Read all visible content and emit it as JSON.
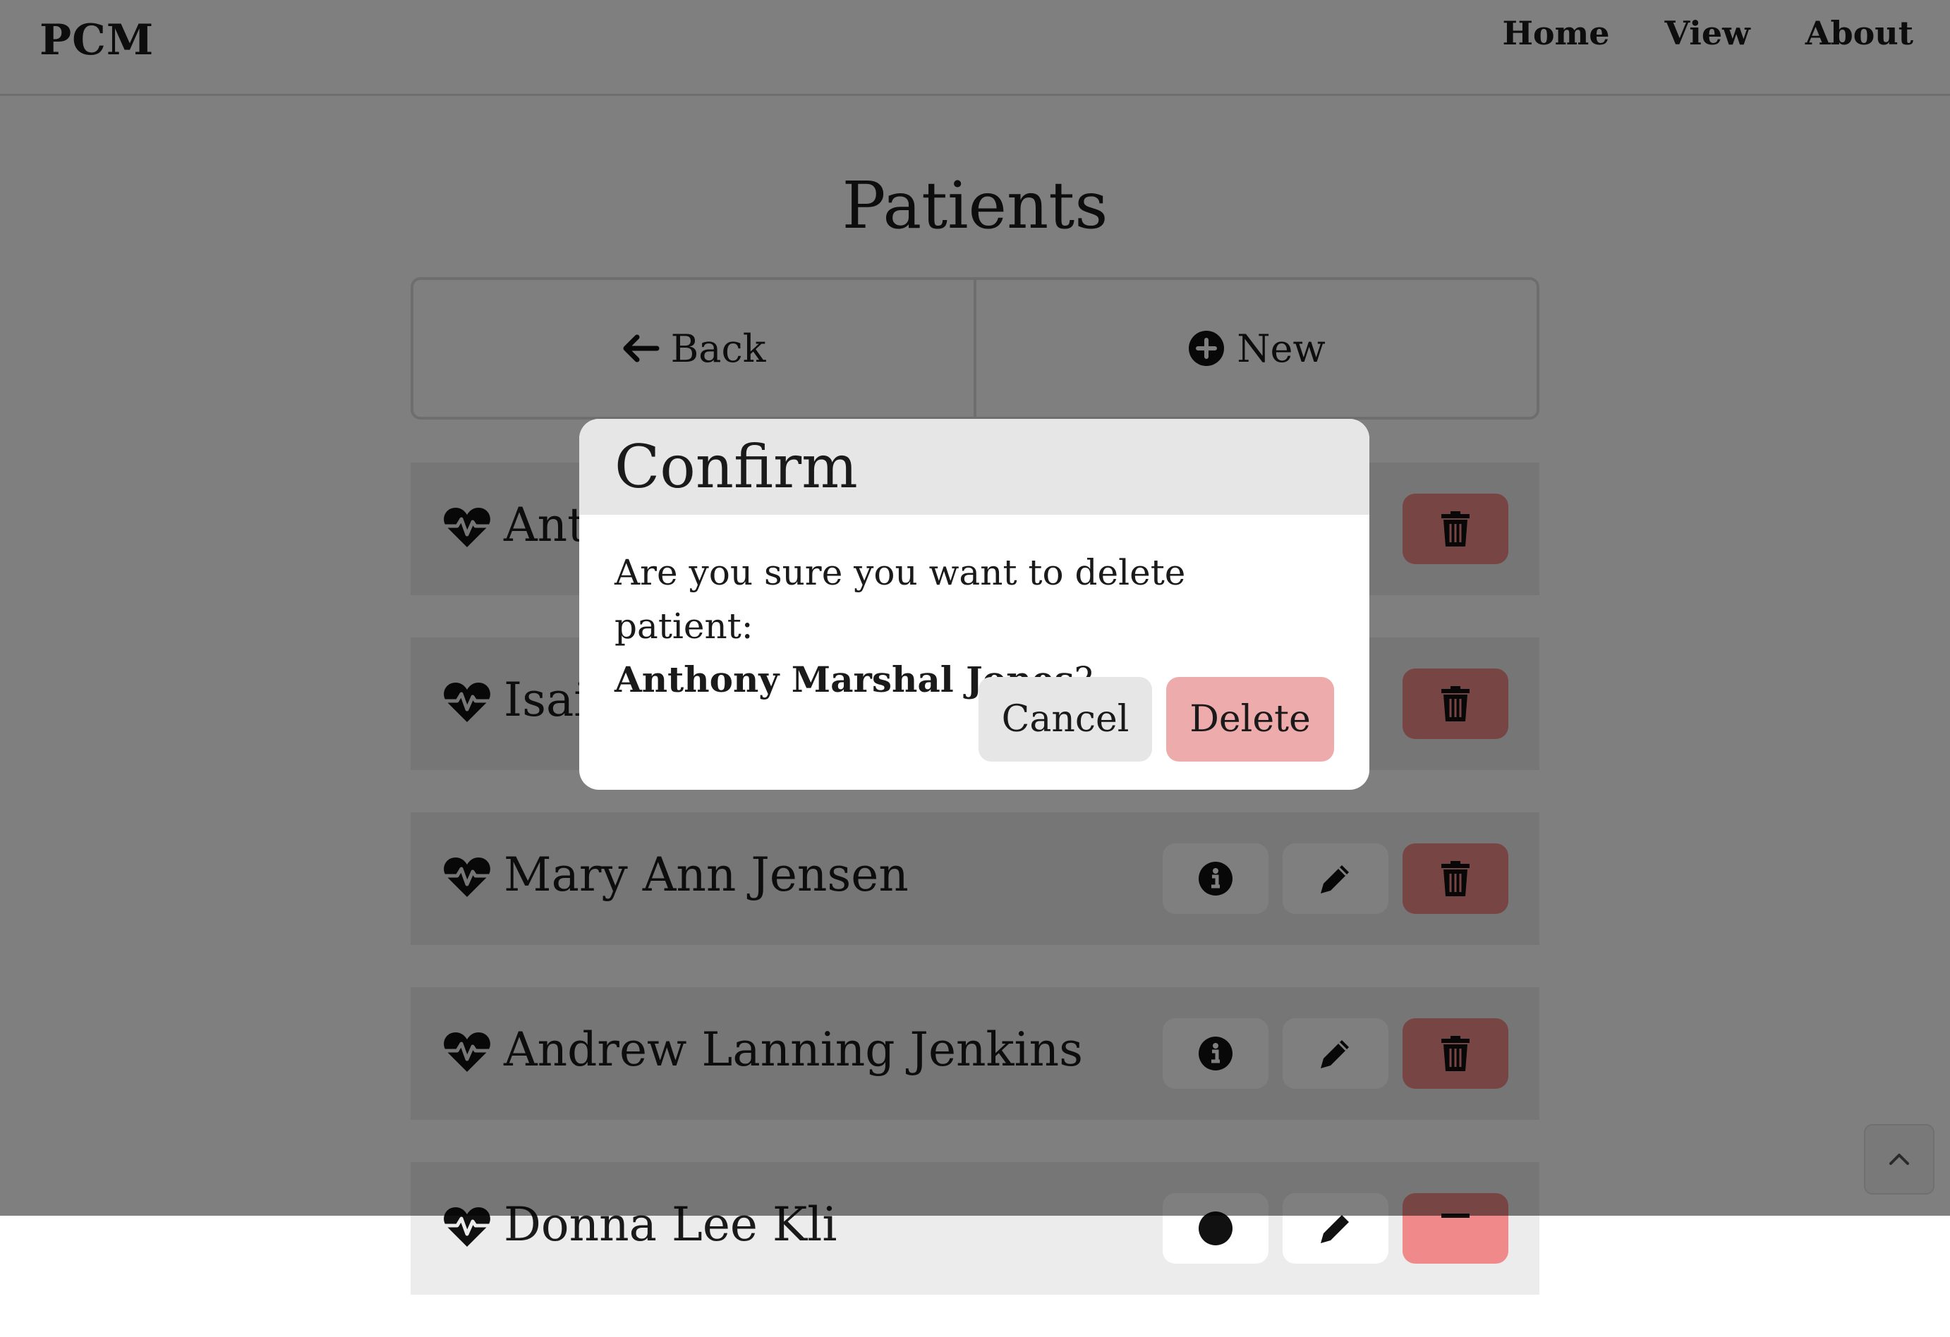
{
  "navbar": {
    "brand": "PCM",
    "links": [
      "Home",
      "View",
      "About"
    ]
  },
  "page_title": "Patients",
  "actions": {
    "back_label": "Back",
    "new_label": "New"
  },
  "patients": [
    {
      "name": "Anthony Marshal Jones",
      "visible_name": "Ant"
    },
    {
      "name": "Isaia",
      "visible_name": "Isaia"
    },
    {
      "name": "Mary Ann Jensen",
      "visible_name": "Mary Ann Jensen"
    },
    {
      "name": "Andrew Lanning Jenkins",
      "visible_name": "Andrew Lanning Jenkins"
    },
    {
      "name": "Donna Lee Kline",
      "visible_name": "Donna Lee Kli"
    }
  ],
  "row_icons": [
    "heartbeat-icon",
    "info-icon",
    "pencil-icon",
    "trash-icon"
  ],
  "modal": {
    "title": "Confirm",
    "message": "Are you sure you want to delete patient:",
    "patient_name": "Anthony Marshal Jones",
    "suffix": "?",
    "cancel_label": "Cancel",
    "delete_label": "Delete"
  },
  "colors": {
    "danger": "#f08a8a",
    "delete_button": "#eeabab",
    "row_bg": "#ececec",
    "overlay": "rgba(0,0,0,0.5)"
  }
}
